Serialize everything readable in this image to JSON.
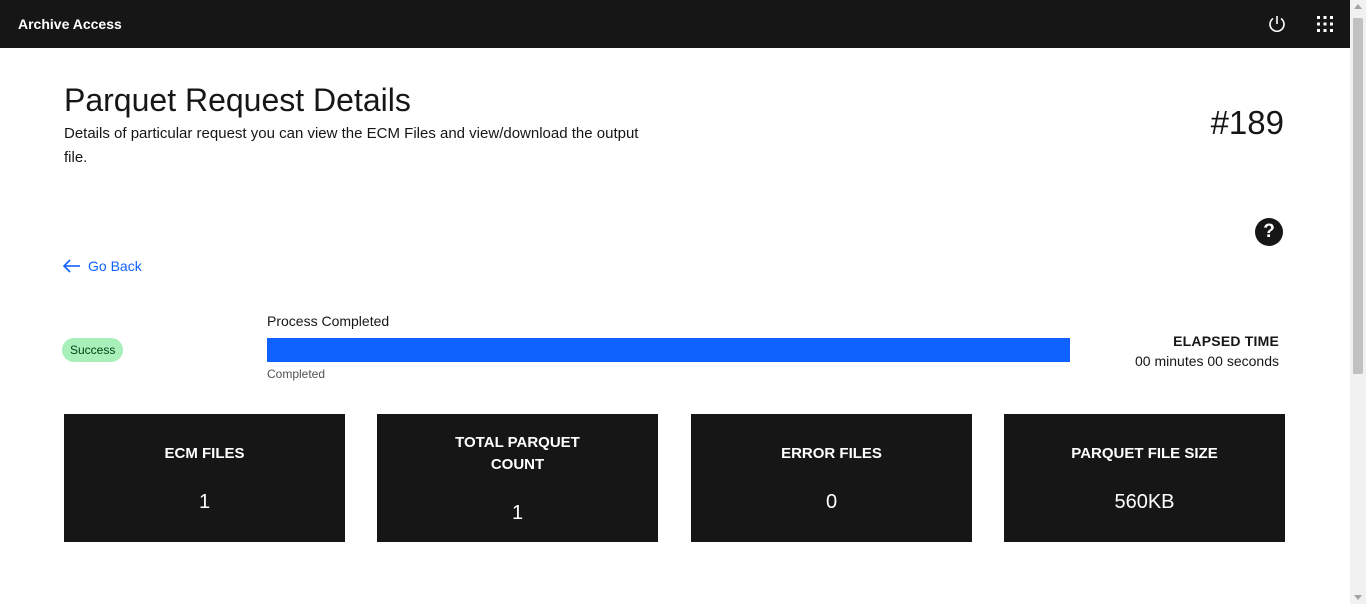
{
  "header": {
    "app_title": "Archive Access",
    "power_icon": "power-icon",
    "switcher_icon": "app-switcher-icon"
  },
  "page": {
    "title": "Parquet Request Details",
    "description": "Details of particular request you can view the ECM Files and view/download the output file.",
    "request_number": "#189",
    "help_icon": "question-mark-icon",
    "help_glyph": "?"
  },
  "nav": {
    "go_back_label": "Go Back",
    "go_back_icon": "arrow-left-icon"
  },
  "status": {
    "badge": "Success",
    "badge_color": "#a7f0ba",
    "progress_label": "Process Completed",
    "progress_helper": "Completed",
    "progress_percent": 100,
    "progress_color": "#0f62fe",
    "elapsed_title": "ELAPSED TIME",
    "elapsed_value": "00 minutes 00 seconds"
  },
  "tiles": [
    {
      "label": "ECM FILES",
      "value": "1"
    },
    {
      "label": "TOTAL PARQUET COUNT",
      "value": "1"
    },
    {
      "label": "ERROR FILES",
      "value": "0"
    },
    {
      "label": "PARQUET FILE SIZE",
      "value": "560KB"
    }
  ]
}
